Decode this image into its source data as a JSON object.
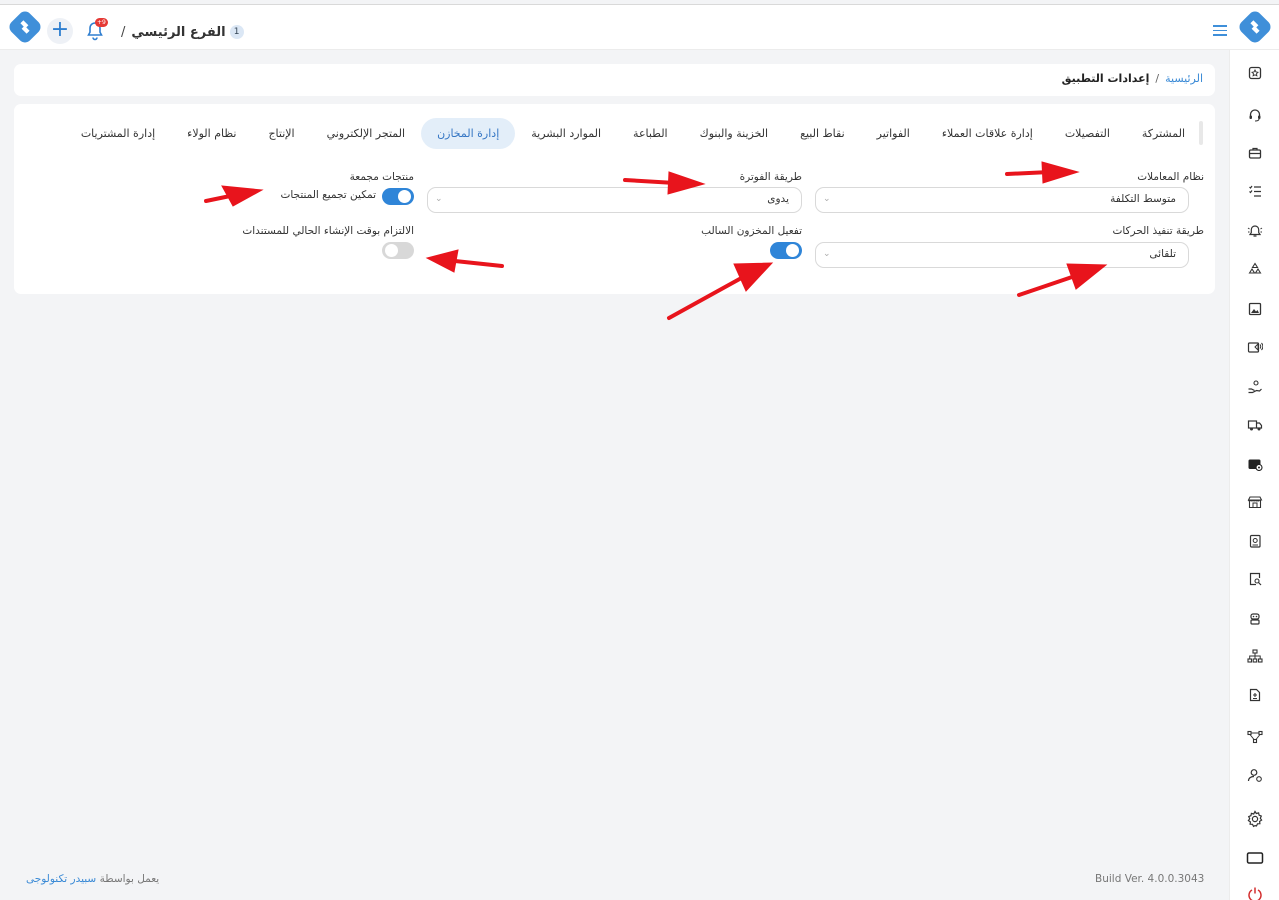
{
  "header": {
    "branch_number": "1",
    "branch_name": "الفرع الرئيسي",
    "branch_separator": "/",
    "notification_badge": "+9",
    "add_label": "+"
  },
  "breadcrumb": {
    "home": "الرئيسية",
    "separator": "/",
    "current": "إعدادات التطبيق"
  },
  "tabs": [
    {
      "label": "المشتركة",
      "active": false
    },
    {
      "label": "التفصيلات",
      "active": false
    },
    {
      "label": "إدارة علاقات العملاء",
      "active": false
    },
    {
      "label": "الفواتير",
      "active": false
    },
    {
      "label": "نقاط البيع",
      "active": false
    },
    {
      "label": "الخزينة والبنوك",
      "active": false
    },
    {
      "label": "الطباعة",
      "active": false
    },
    {
      "label": "الموارد البشرية",
      "active": false
    },
    {
      "label": "إدارة المخازن",
      "active": true
    },
    {
      "label": "المتجر الإلكتروني",
      "active": false
    },
    {
      "label": "الإنتاج",
      "active": false
    },
    {
      "label": "نظام الولاء",
      "active": false
    },
    {
      "label": "إدارة المشتريات",
      "active": false
    }
  ],
  "settings": {
    "transactions_system": {
      "label": "نظام المعاملات",
      "value": "متوسط التكلفة"
    },
    "movements_execution": {
      "label": "طريقة تنفيذ الحركات",
      "value": "تلقائى"
    },
    "invoice_method": {
      "label": "طريقة الفوترة",
      "value": "يدوى"
    },
    "negative_stock": {
      "label": "تفعيل المخزون السالب",
      "enabled": true
    },
    "bundled_products": {
      "label": "منتجات مجمعة",
      "toggle_label": "تمكين تجميع المنتجات",
      "enabled": true
    },
    "creation_time": {
      "label": "الالتزام بوقت الإنشاء الحالي للمستندات",
      "enabled": false
    }
  },
  "sidebar_icons": [
    "star-doc-icon",
    "headset-icon",
    "briefcase-icon",
    "checklist-icon",
    "bell-alert-icon",
    "recycle-icon",
    "image-icon",
    "broadcast-icon",
    "hand-coin-icon",
    "delivery-icon",
    "wallet-gear-icon",
    "store-icon",
    "book-icon",
    "search-doc-icon",
    "robot-icon",
    "hierarchy-icon",
    "invoice-icon",
    "network-icon",
    "user-settings-icon",
    "gear-icon",
    "window-icon",
    "power-icon"
  ],
  "footer": {
    "powered_prefix": "يعمل بواسطة",
    "company": "سبيدر تكنولوجى",
    "build": "Build Ver. 4.0.0.3043"
  },
  "colors": {
    "accent": "#2f85d8",
    "active_tab_bg": "#e3eef9",
    "arrow": "#e8141c",
    "notification": "#e53935"
  }
}
